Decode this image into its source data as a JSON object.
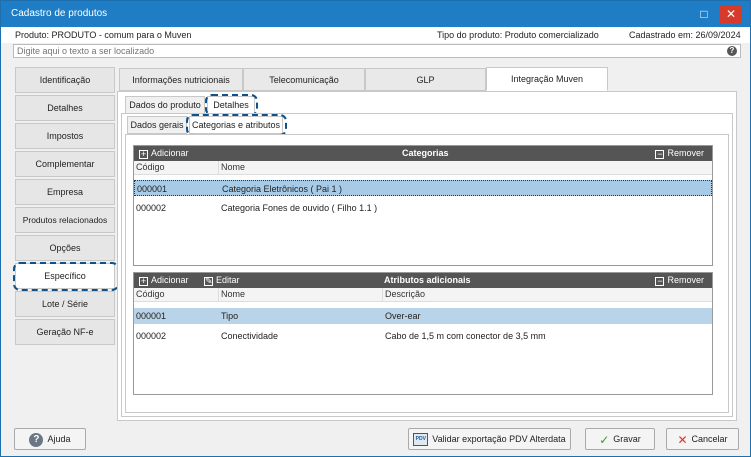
{
  "window": {
    "title": "Cadastro de produtos",
    "max_glyph": "□",
    "close_glyph": "✕"
  },
  "info": {
    "produto": "Produto: PRODUTO - comum para o Muven",
    "tipo": "Tipo do produto: Produto comercializado",
    "cadastrado": "Cadastrado em: 26/09/2024"
  },
  "search": {
    "placeholder": "Digite aqui o texto a ser localizado",
    "help": "?"
  },
  "sidebar": {
    "items": [
      {
        "label": "Identificação"
      },
      {
        "label": "Detalhes"
      },
      {
        "label": "Impostos"
      },
      {
        "label": "Complementar"
      },
      {
        "label": "Empresa"
      },
      {
        "label": "Produtos relacionados"
      },
      {
        "label": "Opções"
      },
      {
        "label": "Específico"
      },
      {
        "label": "Lote / Série"
      },
      {
        "label": "Geração NF-e"
      }
    ]
  },
  "main_tabs": [
    {
      "label": "Informações nutricionais"
    },
    {
      "label": "Telecomunicação"
    },
    {
      "label": "GLP"
    },
    {
      "label": "Integração Muven"
    }
  ],
  "sub_tabs": [
    {
      "label": "Dados do produto"
    },
    {
      "label": "Detalhes"
    }
  ],
  "sub_tabs2": [
    {
      "label": "Dados gerais"
    },
    {
      "label": "Categorias e atributos"
    }
  ],
  "categorias": {
    "add": "Adicionar",
    "title": "Categorias",
    "remove": "Remover",
    "columns": [
      "Código",
      "Nome"
    ],
    "rows": [
      {
        "codigo": "000001",
        "nome": "Categoria Eletrônicos ( Pai 1 )"
      },
      {
        "codigo": "000002",
        "nome": "Categoria Fones de ouvido ( Filho 1.1 )"
      }
    ]
  },
  "atributos": {
    "add": "Adicionar",
    "edit": "Editar",
    "title": "Atributos adicionais",
    "remove": "Remover",
    "columns": [
      "Código",
      "Nome",
      "Descrição"
    ],
    "rows": [
      {
        "codigo": "000001",
        "nome": "Tipo",
        "descricao": "Over-ear"
      },
      {
        "codigo": "000002",
        "nome": "Conectividade",
        "descricao": "Cabo de 1,5 m com conector de 3,5 mm"
      }
    ]
  },
  "buttons": {
    "ajuda": "Ajuda",
    "validar": "Validar exportação PDV Alterdata",
    "pdv_icon_text": "PDV",
    "gravar": "Gravar",
    "cancelar": "Cancelar"
  },
  "colors": {
    "titlebar": "#1e7dc4",
    "selection": "#a7cbe6",
    "grid_header": "#555555",
    "focus_dash": "#10518a"
  }
}
